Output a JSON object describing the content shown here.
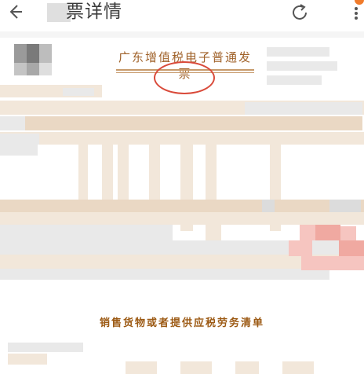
{
  "header": {
    "title": "票详情",
    "back_icon": "back-arrow-icon",
    "refresh_icon": "refresh-icon",
    "more_icon": "more-vertical-icon"
  },
  "invoice": {
    "title": "广东增值税电子普通发票"
  },
  "section": {
    "title": "销售货物或者提供应税劳务清单"
  },
  "colors": {
    "accent": "#a0622a",
    "stamp": "#d94a3a",
    "section_title": "#9c5a14"
  }
}
